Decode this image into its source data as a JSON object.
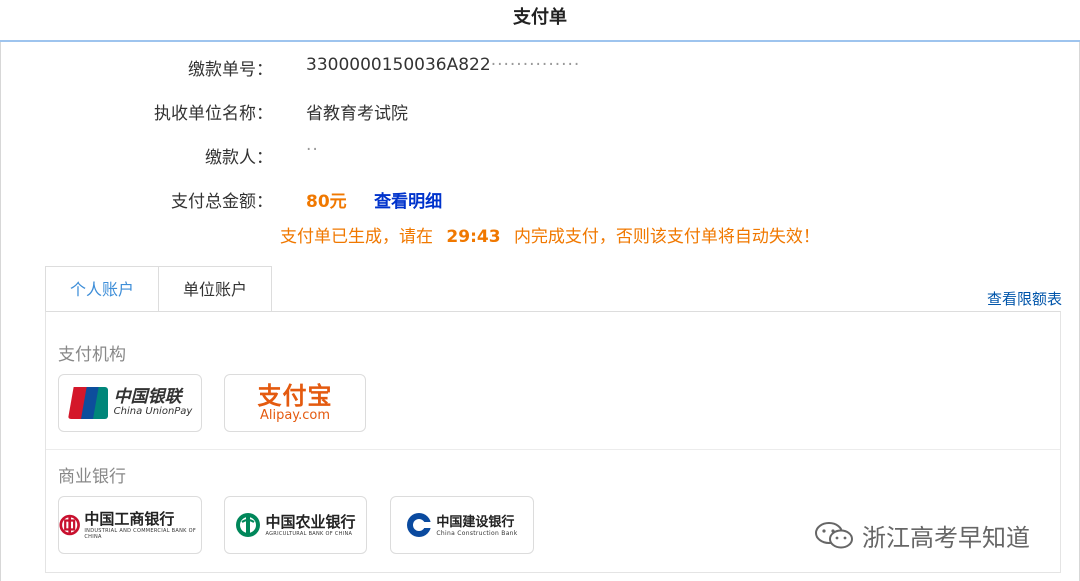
{
  "header": {
    "title": "支付单"
  },
  "order": {
    "number_label": "缴款单号：",
    "number_value": "3300000150036A822",
    "number_masked": "··············",
    "unit_label": "执收单位名称：",
    "unit_value": "省教育考试院",
    "payer_label": "缴款人：",
    "payer_masked": "··",
    "total_label": "支付总金额：",
    "total_value": "80元",
    "detail_link": "查看明细"
  },
  "notice": {
    "prefix": "支付单已生成，请在",
    "timer": "29:43",
    "suffix": "内完成支付，否则该支付单将自动失效！"
  },
  "tabs": [
    {
      "label": "个人账户",
      "active": true
    },
    {
      "label": "单位账户",
      "active": false
    }
  ],
  "limit_link": "查看限额表",
  "sections": {
    "institutions_title": "支付机构",
    "banks_title": "商业银行"
  },
  "methods": {
    "unionpay": {
      "badge_top": "UnionPay",
      "badge_bottom": "银联",
      "name_cn": "中国银联",
      "name_en": "China UnionPay"
    },
    "alipay": {
      "name_cn": "支付宝",
      "name_en": "Alipay.com"
    }
  },
  "banks": {
    "icbc": {
      "name": "中国工商银行",
      "sub": "INDUSTRIAL AND COMMERCIAL BANK OF CHINA",
      "color": "#c8102e"
    },
    "abc": {
      "name": "中国农业银行",
      "sub": "AGRICULTURAL BANK OF CHINA",
      "color": "#00875a"
    },
    "ccb": {
      "name": "中国建设银行",
      "sub": "China Construction Bank",
      "color": "#0a4a9f"
    }
  },
  "watermark": {
    "text": "浙江高考早知道"
  }
}
